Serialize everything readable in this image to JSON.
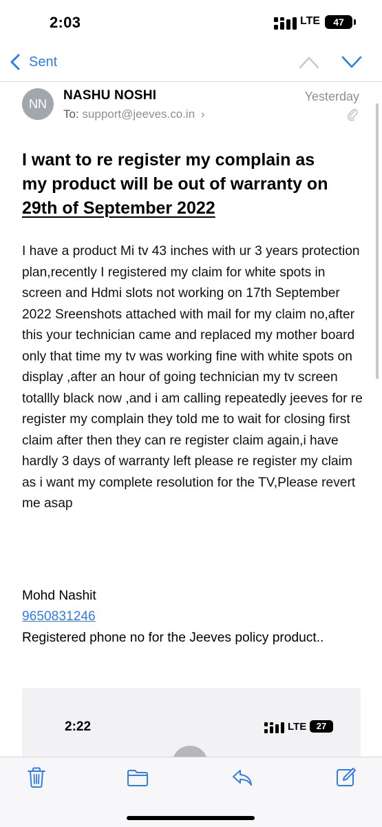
{
  "status_bar": {
    "time": "2:03",
    "network": "LTE",
    "battery": "47"
  },
  "nav": {
    "back_label": "Sent",
    "back_icon": "chevron-left-icon",
    "prev_icon": "chevron-up-icon",
    "next_icon": "chevron-down-icon"
  },
  "message": {
    "avatar_initials": "NN",
    "sender": "NASHU NOSHI",
    "date": "Yesterday",
    "to_label": "To:",
    "to_address": "support@jeeves.co.in",
    "to_chevron": "›",
    "subject_line1": "I want to re register my complain as",
    "subject_line2": "my product will be out of warranty on",
    "subject_line3": "29th of September 2022",
    "body": "I have a product Mi tv 43 inches with ur 3 years protection plan,recently I registered my claim for white spots in screen and Hdmi slots not working on 17th September 2022 Sreenshots attached with mail for my claim no,after this your technician came and replaced my mother board only that time my tv was working fine with white spots on display ,after an hour of going technician my tv screen totallly black now ,and i am calling repeatedly jeeves for re register my complain they told me to wait for closing first claim after then they can re register claim again,i have hardly 3 days of warranty left please re register my claim as i want my complete resolution for the TV,Please revert me asap",
    "signature_name": "Mohd Nashit",
    "signature_phone": "9650831246",
    "signature_note": "Registered phone no for the Jeeves policy product.."
  },
  "attachment_preview": {
    "time": "2:22",
    "network": "LTE",
    "battery": "27"
  },
  "toolbar": {
    "icons": [
      "trash-icon",
      "folder-icon",
      "reply-icon",
      "compose-icon"
    ]
  },
  "colors": {
    "accent": "#2f7bf0",
    "secondary_text": "#8e8e93",
    "avatar_bg": "#a2a6ad"
  }
}
